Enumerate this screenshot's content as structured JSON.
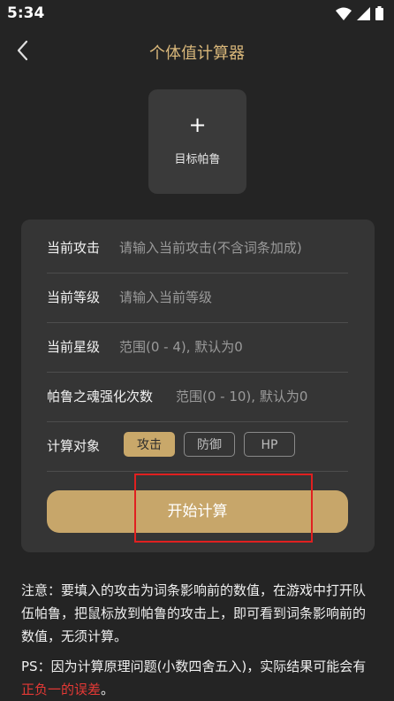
{
  "status_bar": {
    "time": "5:34"
  },
  "header": {
    "title": "个体值计算器"
  },
  "target": {
    "plus": "+",
    "label": "目标帕鲁"
  },
  "form": {
    "attack": {
      "label": "当前攻击",
      "placeholder": "请输入当前攻击(不含词条加成)"
    },
    "level": {
      "label": "当前等级",
      "placeholder": "请输入当前等级"
    },
    "star": {
      "label": "当前星级",
      "placeholder": "范围(0 - 4), 默认为0"
    },
    "soul": {
      "label": "帕鲁之魂强化次数",
      "placeholder": "范围(0 - 10), 默认为0"
    },
    "target": {
      "label": "计算对象",
      "options": [
        "攻击",
        "防御",
        "HP"
      ],
      "selected": "攻击"
    },
    "start_label": "开始计算"
  },
  "notes": {
    "note1": "注意：要填入的攻击为词条影响前的数值，在游戏中打开队伍帕鲁，把鼠标放到帕鲁的攻击上，即可看到词条影响前的数值，无须计算。",
    "note2_prefix": "PS：因为计算原理问题(小数四舍五入)，实际结果可能会有",
    "note2_highlight": "正负一的误差",
    "note2_suffix": "。"
  },
  "colors": {
    "accent": "#c9a86a",
    "title": "#d9b77a",
    "warning": "#e53935",
    "background": "#242424",
    "card": "#353535"
  }
}
